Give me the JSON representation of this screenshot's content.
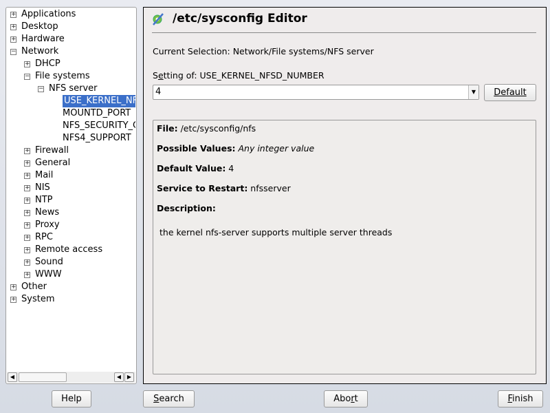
{
  "tree": [
    {
      "label": "Applications",
      "level": 0,
      "state": "collapsed"
    },
    {
      "label": "Desktop",
      "level": 0,
      "state": "collapsed"
    },
    {
      "label": "Hardware",
      "level": 0,
      "state": "collapsed"
    },
    {
      "label": "Network",
      "level": 0,
      "state": "expanded"
    },
    {
      "label": "DHCP",
      "level": 1,
      "state": "collapsed"
    },
    {
      "label": "File systems",
      "level": 1,
      "state": "expanded"
    },
    {
      "label": "NFS server",
      "level": 2,
      "state": "expanded"
    },
    {
      "label": "USE_KERNEL_NFSD_NUMBER",
      "level": 3,
      "state": "selected"
    },
    {
      "label": "MOUNTD_PORT",
      "level": 3,
      "state": "leaf"
    },
    {
      "label": "NFS_SECURITY_GSS",
      "level": 3,
      "state": "leaf"
    },
    {
      "label": "NFS4_SUPPORT",
      "level": 3,
      "state": "leaf"
    },
    {
      "label": "Firewall",
      "level": 1,
      "state": "collapsed"
    },
    {
      "label": "General",
      "level": 1,
      "state": "collapsed"
    },
    {
      "label": "Mail",
      "level": 1,
      "state": "collapsed"
    },
    {
      "label": "NIS",
      "level": 1,
      "state": "collapsed"
    },
    {
      "label": "NTP",
      "level": 1,
      "state": "collapsed"
    },
    {
      "label": "News",
      "level": 1,
      "state": "collapsed"
    },
    {
      "label": "Proxy",
      "level": 1,
      "state": "collapsed"
    },
    {
      "label": "RPC",
      "level": 1,
      "state": "collapsed"
    },
    {
      "label": "Remote access",
      "level": 1,
      "state": "collapsed"
    },
    {
      "label": "Sound",
      "level": 1,
      "state": "collapsed"
    },
    {
      "label": "WWW",
      "level": 1,
      "state": "collapsed"
    },
    {
      "label": "Other",
      "level": 0,
      "state": "collapsed"
    },
    {
      "label": "System",
      "level": 0,
      "state": "collapsed"
    }
  ],
  "header": {
    "title": "/etc/sysconfig Editor"
  },
  "current_selection": "Current Selection: Network/File systems/NFS server",
  "setting": {
    "label_pre": "S",
    "label_mn": "e",
    "label_post": "tting of: USE_KERNEL_NFSD_NUMBER",
    "value": "4",
    "default_label": "Default"
  },
  "info": {
    "file_label": "File:",
    "file_value": " /etc/sysconfig/nfs",
    "possible_label": "Possible Values:",
    "possible_value": " Any integer value",
    "default_label": "Default Value:",
    "default_value": " 4",
    "service_label": "Service to Restart:",
    "service_value": " nfsserver",
    "description_label": "Description:",
    "description": "the kernel nfs-server supports multiple server threads"
  },
  "buttons": {
    "help": "Help",
    "search_mn": "S",
    "search_rest": "earch",
    "abort_pre": "Abo",
    "abort_mn": "r",
    "abort_post": "t",
    "finish_mn": "F",
    "finish_rest": "inish"
  }
}
